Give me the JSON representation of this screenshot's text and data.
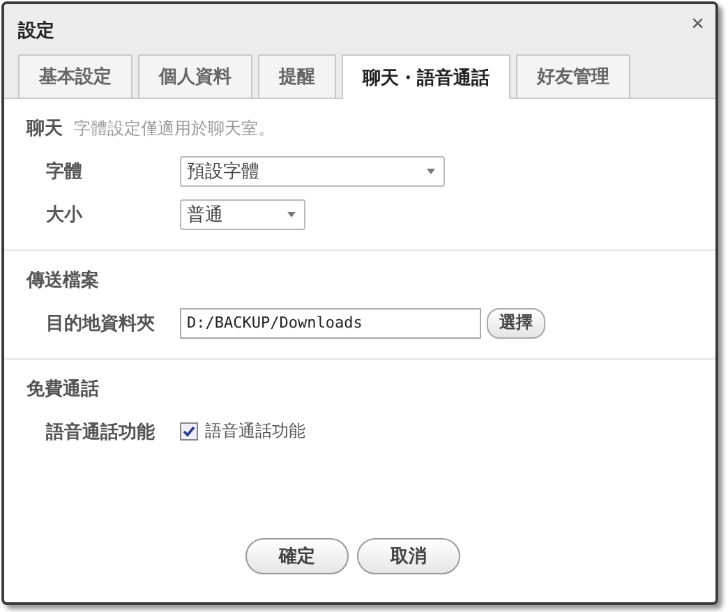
{
  "window": {
    "title": "設定",
    "close": "×"
  },
  "tabs": [
    {
      "label": "基本設定",
      "selected": false
    },
    {
      "label": "個人資料",
      "selected": false
    },
    {
      "label": "提醒",
      "selected": false
    },
    {
      "label": "聊天・語音通話",
      "selected": true
    },
    {
      "label": "好友管理",
      "selected": false
    }
  ],
  "sections": [
    {
      "title": "聊天",
      "note": "字體設定僅適用於聊天室。",
      "rows": [
        {
          "kind": "select",
          "label": "字體",
          "value": "預設字體"
        },
        {
          "kind": "short_select",
          "label": "大小",
          "value": "普通"
        }
      ]
    },
    {
      "title": "傳送檔案",
      "rows": [
        {
          "kind": "path",
          "label": "目的地資料夾",
          "value": "D:/BACKUP/Downloads",
          "button": "選擇"
        }
      ]
    },
    {
      "title": "免費通話",
      "rows": [
        {
          "kind": "checkbox",
          "label": "語音通話功能",
          "text": "語音通話功能",
          "checked": true
        }
      ]
    }
  ],
  "buttons": [
    "確定",
    "取消"
  ]
}
